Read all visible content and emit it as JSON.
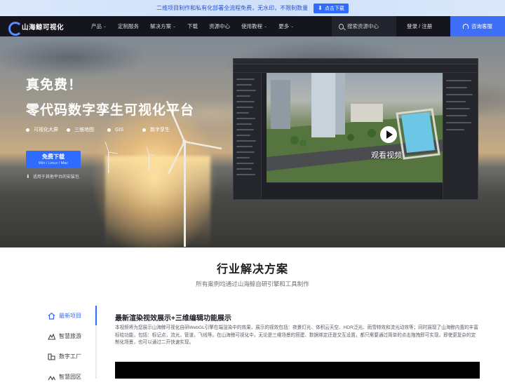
{
  "promo": {
    "text": "二维项目制作和私有化部署全流程免费，无水印，不限制数量",
    "button_label": "点击下载"
  },
  "nav": {
    "logo_text": "山海鲸可视化",
    "menu": [
      {
        "label": "产品",
        "has_dropdown": true
      },
      {
        "label": "定制服务",
        "has_dropdown": false
      },
      {
        "label": "解决方案",
        "has_dropdown": true
      },
      {
        "label": "下载",
        "has_dropdown": false
      },
      {
        "label": "资源中心",
        "has_dropdown": false
      },
      {
        "label": "使用教程",
        "has_dropdown": true
      },
      {
        "label": "更多",
        "has_dropdown": true
      }
    ],
    "search_placeholder": "搜索资源中心",
    "login_label": "登录 / 注册",
    "consult_label": "咨询客服"
  },
  "hero": {
    "title_line1": "真免费！",
    "title_line2": "零代码数字孪生可视化平台",
    "tags": [
      "可视化大屏",
      "三维地图",
      "GIS",
      "数字孪生"
    ],
    "download_button": {
      "label": "免费下载",
      "sublabel": "Win / Linux / Mac"
    },
    "other_platforms": "适用于其他平台的安装包",
    "video_label": "观看视频"
  },
  "solutions": {
    "title": "行业解决方案",
    "subtitle": "所有案例均通过山海鲸自研引擎和工具制作",
    "sidebar": [
      {
        "label": "最新项目",
        "icon": "home-icon",
        "active": true
      },
      {
        "label": "智慧旅游",
        "icon": "landscape-icon",
        "active": false
      },
      {
        "label": "数字工厂",
        "icon": "factory-icon",
        "active": false
      },
      {
        "label": "智慧园区",
        "icon": "park-icon",
        "active": false
      }
    ],
    "article": {
      "title": "最新渲染视效展示+三维编辑功能展示",
      "body": "本视频将为您展示山海鲸可视化自研WebGL引擎在端渲染中的效果，展示的视效包括：夜景灯光、体积云天空、HDR泛光、雨雪特效和流光动效等；同时展现了山海鲸内置的丰富标绘功能，包括：标记点，流光，管道，飞线等。在山海鲸可视化中，无论是三维场景的搭建、数据绑定还是交互设置，都只需要通过简单的点击拖拽即可实现，即使更复杂的定制化场景，也可以通过二开快速实现。"
    }
  },
  "colors": {
    "accent": "#2f6bff",
    "nav_bg": "#15161d",
    "consult_bg": "#3f6ff6"
  }
}
